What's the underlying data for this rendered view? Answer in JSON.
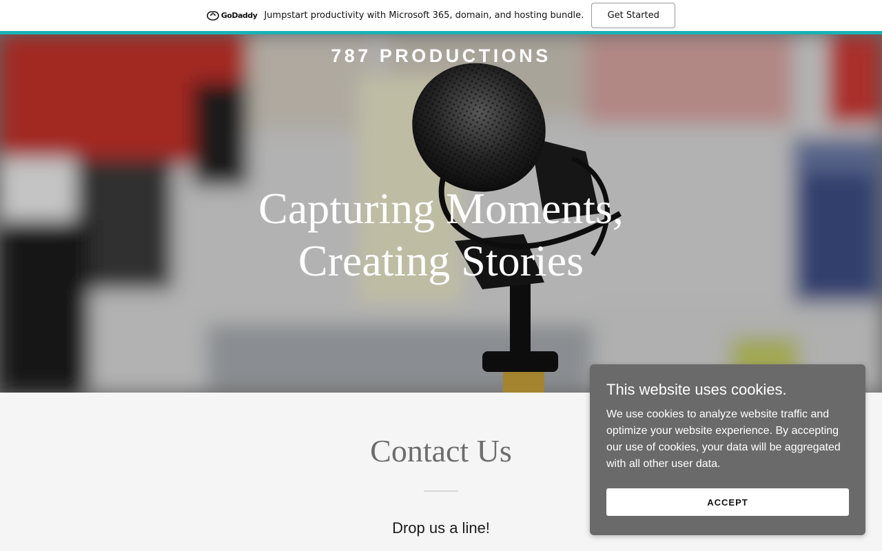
{
  "promo": {
    "logo_icon": "godaddy-logo-icon",
    "logo_text": "GoDaddy",
    "text": "Jumpstart productivity with Microsoft 365, domain, and hosting bundle.",
    "cta_label": "Get Started",
    "accent_color": "#1bb1b4"
  },
  "hero": {
    "site_title": "787 PRODUCTIONS",
    "heading_line1": "Capturing Moments,",
    "heading_line2": "Creating Stories",
    "background": "studio-microphone-photo"
  },
  "contact": {
    "title": "Contact Us",
    "subtitle": "Drop us a line!"
  },
  "cookie_banner": {
    "title": "This website uses cookies.",
    "body": "We use cookies to analyze website traffic and optimize your website experience. By accepting our use of cookies, your data will be aggregated with all other user data.",
    "accept_label": "ACCEPT"
  }
}
